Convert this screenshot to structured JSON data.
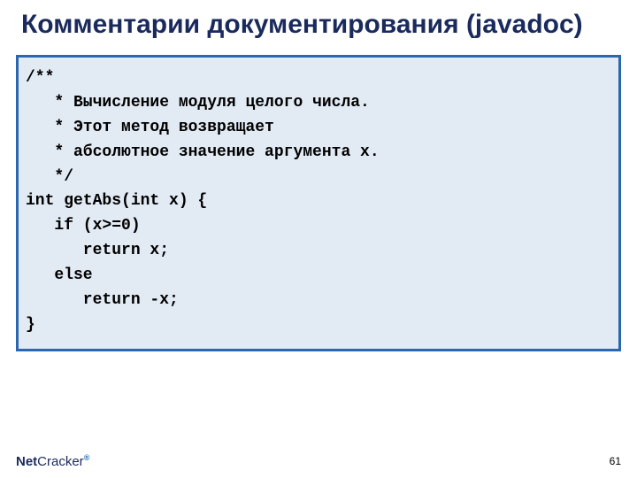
{
  "title": "Комментарии документирования (javadoc)",
  "code": "/**\n   * Вычисление модуля целого числа.\n   * Этот метод возвращает\n   * абсолютное значение аргумента x.\n   */\nint getAbs(int x) {\n   if (x>=0)\n      return x;\n   else\n      return -x;\n}",
  "logo": {
    "part1": "Net",
    "part2": "Cracker",
    "reg": "®"
  },
  "page_number": "61"
}
